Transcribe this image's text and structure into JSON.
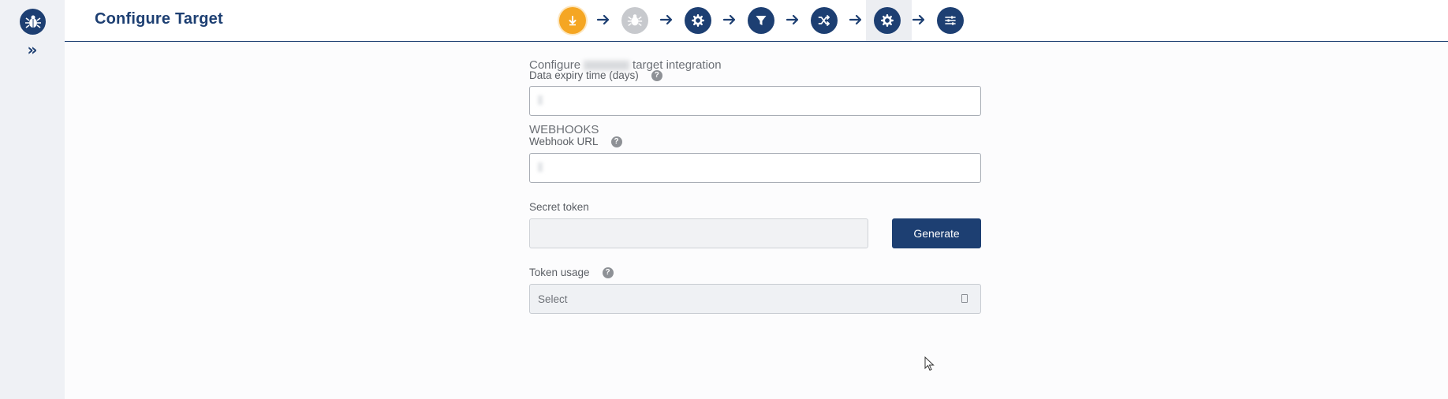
{
  "app": {
    "logo_icon": "spider-icon"
  },
  "sidebar": {
    "expand_label": "»"
  },
  "header": {
    "title": "Configure Target",
    "steps": [
      {
        "name": "source",
        "icon": "download-icon",
        "state": "done"
      },
      {
        "name": "target",
        "icon": "spider-icon",
        "state": "inactive"
      },
      {
        "name": "settings",
        "icon": "gear-icon",
        "state": "done"
      },
      {
        "name": "filter",
        "icon": "filter-icon",
        "state": "done"
      },
      {
        "name": "transform",
        "icon": "shuffle-icon",
        "state": "done"
      },
      {
        "name": "configure-target",
        "icon": "gear-icon",
        "state": "current"
      },
      {
        "name": "review",
        "icon": "sliders-icon",
        "state": "done"
      }
    ]
  },
  "form": {
    "heading_prefix": "Configure",
    "heading_suffix": "target integration",
    "expiry_label": "Data expiry time (days)",
    "webhooks_title": "WEBHOOKS",
    "webhook_url_label": "Webhook URL",
    "secret_token_label": "Secret token",
    "generate_label": "Generate",
    "token_usage_label": "Token usage",
    "token_usage_value": "Select",
    "help_glyph": "?"
  },
  "colors": {
    "primary": "#1d3f72",
    "accent": "#f5a623",
    "inactive": "#c7c9cd"
  }
}
